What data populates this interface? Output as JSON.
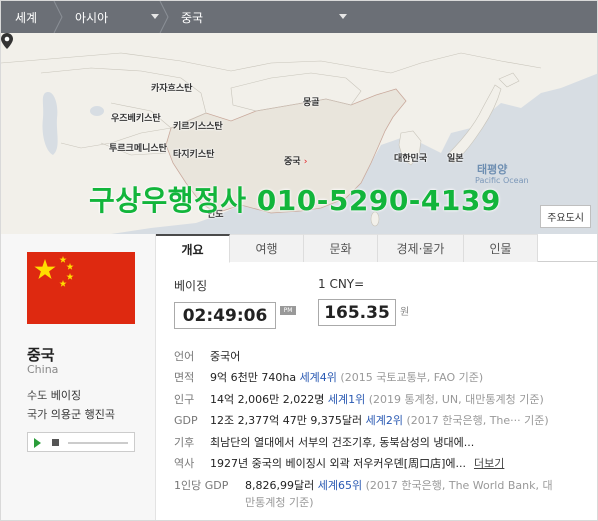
{
  "breadcrumb": {
    "world": "세계",
    "region": "아시아",
    "country": "중국"
  },
  "map": {
    "labels": {
      "kazakhstan": "카자흐스탄",
      "mongolia": "몽골",
      "uzbekistan": "우즈베키스탄",
      "kyrgyzstan": "키르기스스탄",
      "turkmenistan": "투르크메니스탄",
      "tajikistan": "타지키스탄",
      "korea": "대한민국",
      "japan": "일본",
      "pacific_ko": "태평양",
      "pacific_en": "Pacific Ocean",
      "india_partial": "인도"
    },
    "selected_country": "중국",
    "selected_arrow": "›",
    "major_cities_button": "주요도시",
    "watermark": "구상우행정사 010-5290-4139"
  },
  "country": {
    "name": "중국",
    "name_en": "China",
    "capital_label": "수도",
    "capital": "베이징",
    "anthem_label": "국가",
    "anthem": "의용군 행진곡"
  },
  "tabs": [
    "개요",
    "여행",
    "문화",
    "경제·물가",
    "인물"
  ],
  "active_tab": 0,
  "clock": {
    "city": "베이징",
    "time": "02:49:06",
    "ampm": "PM"
  },
  "currency": {
    "label": "1 CNY=",
    "value": "165.35",
    "unit": "원"
  },
  "info": {
    "language": {
      "label": "언어",
      "value": "중국어"
    },
    "area": {
      "label": "면적",
      "value": "9억 6천만 740ha",
      "rank": "세계4위",
      "source": "(2015 국토교통부, FAO 기준)"
    },
    "population": {
      "label": "인구",
      "value": "14억 2,006만 2,022명",
      "rank": "세계1위",
      "source": "(2019 통계청, UN, 대만통계청 기준)"
    },
    "gdp": {
      "label": "GDP",
      "value": "12조 2,377억 47만 9,375달러",
      "rank": "세계2위",
      "source": "(2017 한국은행, The··· 기준)"
    },
    "climate": {
      "label": "기후",
      "value": "최남단의 열대에서 서부의 건조기후, 동북삼성의 냉대에..."
    },
    "history": {
      "label": "역사",
      "value": "1927년 중국의 베이징시 외곽 저우커우뎬[周口店]에...",
      "more": "더보기"
    },
    "gdp_per_capita": {
      "label": "1인당 GDP",
      "value": "8,826,99달러",
      "rank": "세계65위",
      "source": "(2017 한국은행, The World Bank, 대",
      "source_cont": "만통계청 기준)"
    }
  },
  "colors": {
    "breadcrumb_bg": "#6b6f76",
    "map_land": "#f2f0ea",
    "map_sea": "#d7dde3",
    "china_fill": "#e9e5dc",
    "flag_red": "#de2910",
    "flag_star": "#ffde00",
    "watermark": "#12b53b",
    "link_blue": "#2858b2"
  },
  "icons": {
    "map_pin": "map-pin-icon",
    "play": "play-icon",
    "stop": "stop-icon"
  }
}
